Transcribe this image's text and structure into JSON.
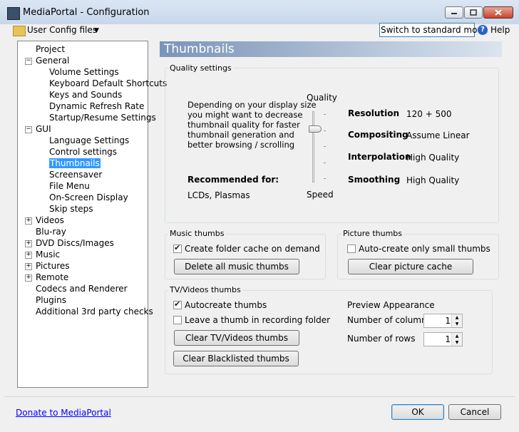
{
  "window": {
    "title": "MediaPortal - Configuration"
  },
  "toolbar": {
    "user_config_files": "User Config files",
    "switch_mode": "Switch to standard mode",
    "help": "Help"
  },
  "tree": {
    "items": [
      {
        "label": "Project",
        "level": 0,
        "expander": ""
      },
      {
        "label": "General",
        "level": 0,
        "expander": "minus"
      },
      {
        "label": "Volume Settings",
        "level": 1,
        "expander": ""
      },
      {
        "label": "Keyboard Default Shortcuts",
        "level": 1,
        "expander": ""
      },
      {
        "label": "Keys and Sounds",
        "level": 1,
        "expander": ""
      },
      {
        "label": "Dynamic Refresh Rate",
        "level": 1,
        "expander": ""
      },
      {
        "label": "Startup/Resume Settings",
        "level": 1,
        "expander": ""
      },
      {
        "label": "GUI",
        "level": 0,
        "expander": "minus"
      },
      {
        "label": "Language Settings",
        "level": 1,
        "expander": ""
      },
      {
        "label": "Control settings",
        "level": 1,
        "expander": ""
      },
      {
        "label": "Thumbnails",
        "level": 1,
        "expander": "",
        "selected": true
      },
      {
        "label": "Screensaver",
        "level": 1,
        "expander": ""
      },
      {
        "label": "File Menu",
        "level": 1,
        "expander": ""
      },
      {
        "label": "On-Screen Display",
        "level": 1,
        "expander": ""
      },
      {
        "label": "Skip steps",
        "level": 1,
        "expander": ""
      },
      {
        "label": "Videos",
        "level": 0,
        "expander": "plus"
      },
      {
        "label": "Blu-ray",
        "level": 0,
        "expander": ""
      },
      {
        "label": "DVD Discs/Images",
        "level": 0,
        "expander": "plus"
      },
      {
        "label": "Music",
        "level": 0,
        "expander": "plus"
      },
      {
        "label": "Pictures",
        "level": 0,
        "expander": "plus"
      },
      {
        "label": "Remote",
        "level": 0,
        "expander": "plus"
      },
      {
        "label": "Codecs and Renderer",
        "level": 0,
        "expander": ""
      },
      {
        "label": "Plugins",
        "level": 0,
        "expander": ""
      },
      {
        "label": "Additional 3rd party checks",
        "level": 0,
        "expander": ""
      }
    ]
  },
  "page": {
    "title": "Thumbnails"
  },
  "quality": {
    "group_label": "Quality settings",
    "description": [
      "Depending on your display size",
      "you might want to decrease",
      "thumbnail quality for faster",
      "thumbnail generation and",
      "better browsing / scrolling"
    ],
    "slider_top": "Quality",
    "slider_bottom": "Speed",
    "recommended_label": "Recommended for:",
    "recommended_value": "LCDs, Plasmas",
    "resolution_label": "Resolution",
    "resolution_value": "120 + 500",
    "compositing_label": "Compositing",
    "compositing_value": "Assume Linear",
    "interpolation_label": "Interpolation",
    "interpolation_value": "High Quality",
    "smoothing_label": "Smoothing",
    "smoothing_value": "High Quality"
  },
  "music": {
    "group_label": "Music thumbs",
    "create_cache": "Create folder cache on demand",
    "create_cache_checked": true,
    "delete_button": "Delete all music thumbs"
  },
  "picture": {
    "group_label": "Picture thumbs",
    "auto_small": "Auto-create only small thumbs",
    "auto_small_checked": false,
    "clear_button": "Clear picture cache"
  },
  "tv": {
    "group_label": "TV/Videos thumbs",
    "autocreate": "Autocreate thumbs",
    "autocreate_checked": true,
    "leave_thumb": "Leave a thumb in recording folder",
    "leave_thumb_checked": false,
    "clear_button": "Clear TV/Videos thumbs",
    "clear_blacklist_button": "Clear Blacklisted thumbs",
    "preview_label": "Preview Appearance",
    "columns_label": "Number of columns",
    "columns_value": "1",
    "rows_label": "Number of rows",
    "rows_value": "1"
  },
  "footer": {
    "donate": "Donate to MediaPortal",
    "ok": "OK",
    "cancel": "Cancel"
  }
}
